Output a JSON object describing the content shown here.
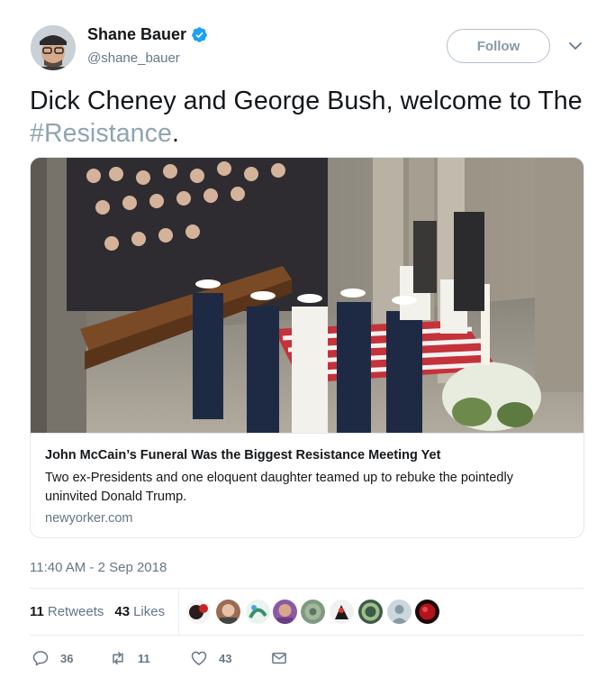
{
  "user": {
    "display_name": "Shane Bauer",
    "handle": "@shane_bauer",
    "follow_label": "Follow"
  },
  "tweet": {
    "text_before": "Dick Cheney and George Bush, welcome to The ",
    "hashtag": "#Resistance",
    "text_after": ".",
    "timestamp": "11:40 AM - 2 Sep 2018"
  },
  "card": {
    "title": "John McCain’s Funeral Was the Biggest Resistance Meeting Yet",
    "description": "Two ex-Presidents and one eloquent daughter teamed up to rebuke the pointedly uninvited Donald Trump.",
    "domain": "newyorker.com"
  },
  "stats": {
    "retweets_count": "11",
    "retweets_label": "Retweets",
    "likes_count": "43",
    "likes_label": "Likes"
  },
  "actions": {
    "replies": "36",
    "retweets": "11",
    "likes": "43"
  },
  "icons": [
    "verified-badge-icon",
    "chevron-down-icon",
    "reply-icon",
    "retweet-icon",
    "heart-icon",
    "envelope-icon"
  ],
  "colors": {
    "verified": "#1da1f2",
    "hashtag": "#8ea4b3",
    "secondary_text": "#657786"
  }
}
